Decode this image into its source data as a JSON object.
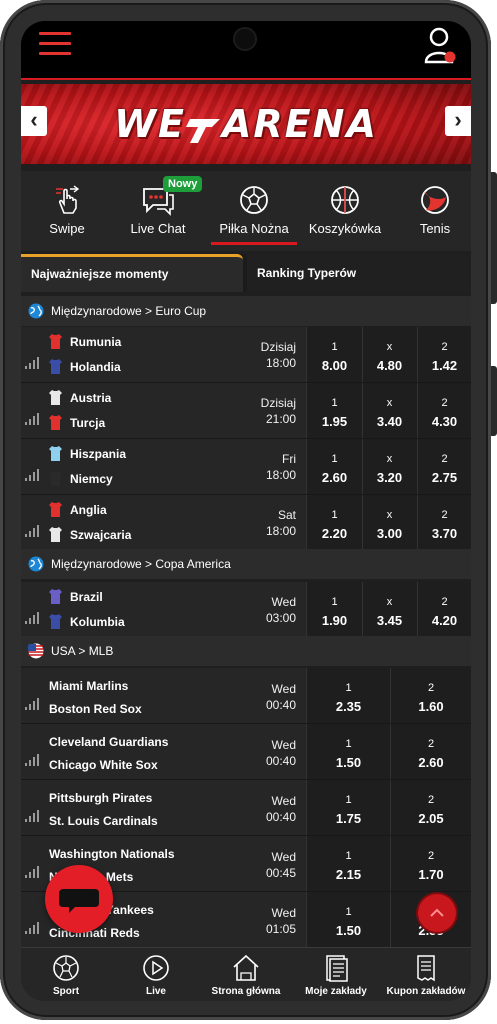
{
  "brand": {
    "logo_text": "WE",
    "logo_text2": "ARENA",
    "accent": "#d61a20"
  },
  "sports_nav": [
    {
      "label": "Swipe",
      "icon": "swipe-icon"
    },
    {
      "label": "Live Chat",
      "icon": "chat-icon",
      "badge": "Nowy"
    },
    {
      "label": "Piłka Nożna",
      "icon": "soccer-ball-icon",
      "active": true
    },
    {
      "label": "Koszykówka",
      "icon": "basketball-icon"
    },
    {
      "label": "Tenis",
      "icon": "tennis-icon"
    }
  ],
  "tabs": {
    "tab1": "Najważniejsze momenty",
    "tab2": "Ranking Typerów"
  },
  "leagues": {
    "euro": "Międzynarodowe > Euro Cup",
    "copa": "Międzynarodowe > Copa America",
    "mlb": "USA > MLB"
  },
  "matches": [
    {
      "home": "Rumunia",
      "away": "Holandia",
      "day": "Dzisiaj",
      "time": "18:00",
      "k1": "1",
      "kx": "x",
      "k2": "2",
      "o1": "8.00",
      "ox": "4.80",
      "o2": "1.42"
    },
    {
      "home": "Austria",
      "away": "Turcja",
      "day": "Dzisiaj",
      "time": "21:00",
      "k1": "1",
      "kx": "x",
      "k2": "2",
      "o1": "1.95",
      "ox": "3.40",
      "o2": "4.30"
    },
    {
      "home": "Hiszpania",
      "away": "Niemcy",
      "day": "Fri",
      "time": "18:00",
      "k1": "1",
      "kx": "x",
      "k2": "2",
      "o1": "2.60",
      "ox": "3.20",
      "o2": "2.75"
    },
    {
      "home": "Anglia",
      "away": "Szwajcaria",
      "day": "Sat",
      "time": "18:00",
      "k1": "1",
      "kx": "x",
      "k2": "2",
      "o1": "2.20",
      "ox": "3.00",
      "o2": "3.70"
    },
    {
      "home": "Brazil",
      "away": "Kolumbia",
      "day": "Wed",
      "time": "03:00",
      "k1": "1",
      "kx": "x",
      "k2": "2",
      "o1": "1.90",
      "ox": "3.45",
      "o2": "4.20"
    }
  ],
  "mlb": [
    {
      "home": "Miami Marlins",
      "away": "Boston Red Sox",
      "day": "Wed",
      "time": "00:40",
      "k1": "1",
      "k2": "2",
      "o1": "2.35",
      "o2": "1.60"
    },
    {
      "home": "Cleveland Guardians",
      "away": "Chicago White Sox",
      "day": "Wed",
      "time": "00:40",
      "k1": "1",
      "k2": "2",
      "o1": "1.50",
      "o2": "2.60"
    },
    {
      "home": "Pittsburgh Pirates",
      "away": "St. Louis Cardinals",
      "day": "Wed",
      "time": "00:40",
      "k1": "1",
      "k2": "2",
      "o1": "1.75",
      "o2": "2.05"
    },
    {
      "home": "Washington Nationals",
      "away": "New York Mets",
      "day": "Wed",
      "time": "00:45",
      "k1": "1",
      "k2": "2",
      "o1": "2.15",
      "o2": "1.70"
    },
    {
      "home": "New York Yankees",
      "away": "Cincinnati Reds",
      "day": "Wed",
      "time": "01:05",
      "k1": "1",
      "k2": "2",
      "o1": "1.50",
      "o2": "2.55"
    }
  ],
  "bottom_nav": [
    {
      "label": "Sport",
      "icon": "soccer-ball-icon"
    },
    {
      "label": "Live",
      "icon": "play-icon"
    },
    {
      "label": "Strona główna",
      "icon": "home-icon"
    },
    {
      "label": "Moje zakłady",
      "icon": "bets-icon"
    },
    {
      "label": "Kupon zakładów",
      "icon": "coupon-icon"
    }
  ]
}
